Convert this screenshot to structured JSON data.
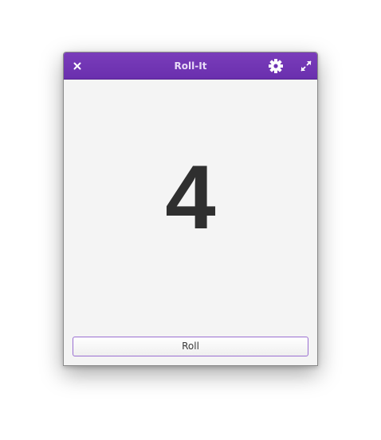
{
  "window": {
    "title": "Roll-It",
    "close_icon": "close-icon",
    "settings_icon": "gear-icon",
    "maximize_icon": "maximize-icon"
  },
  "main": {
    "result": "4"
  },
  "actions": {
    "roll_label": "Roll"
  },
  "colors": {
    "titlebar": "#6e33b2",
    "accent": "#9a6fd1",
    "background": "#f4f4f4",
    "result_text": "#2f2f2f"
  }
}
